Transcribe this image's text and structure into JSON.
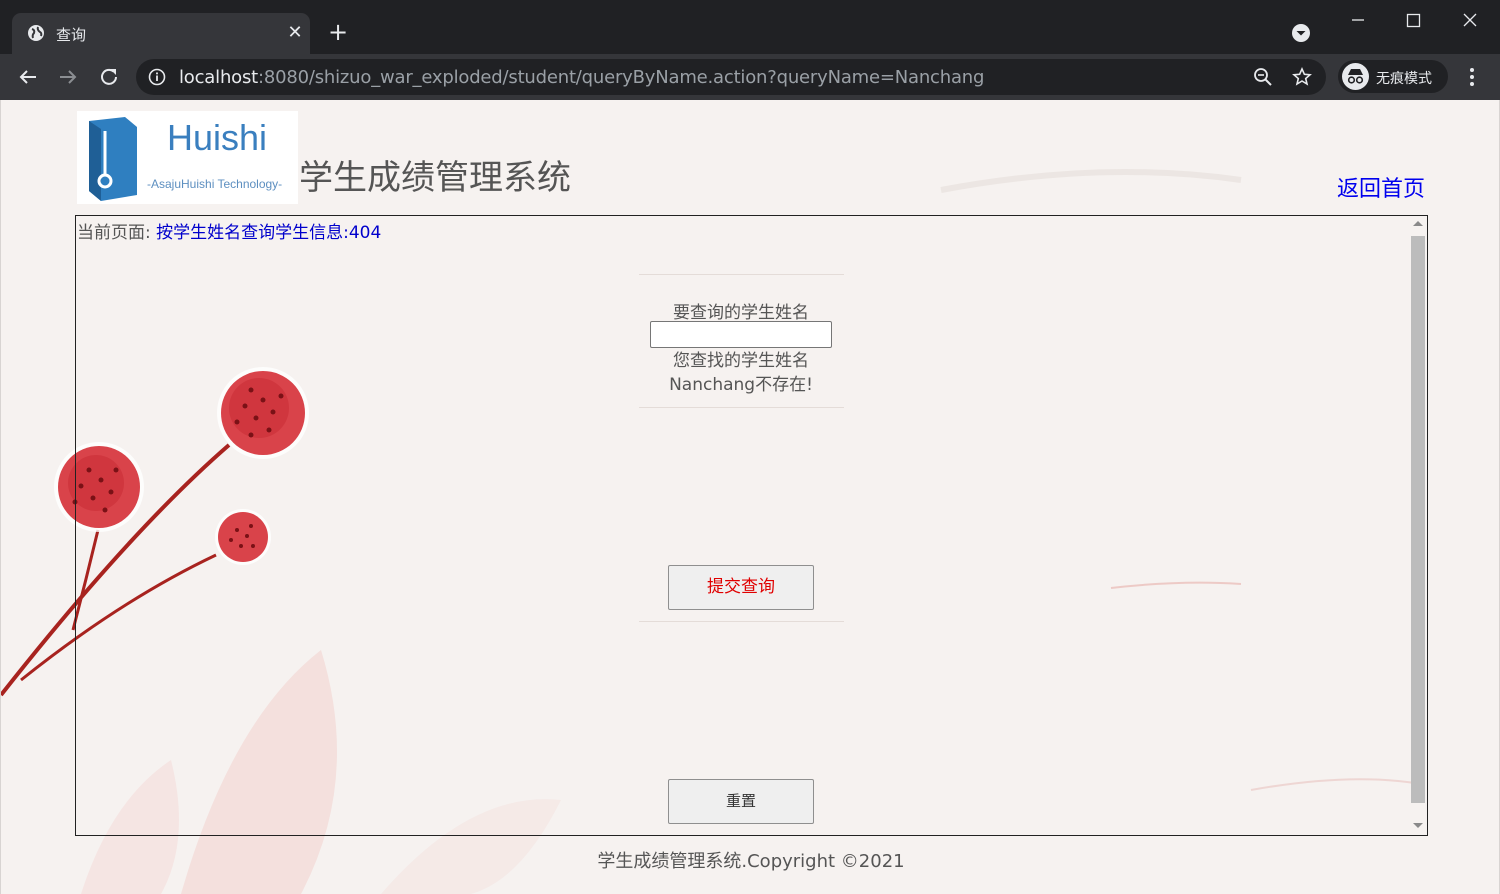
{
  "browser": {
    "tab_title": "查询",
    "url_host": "localhost",
    "url_rest": ":8080/shizuo_war_exploded/student/queryByName.action?queryName=Nanchang",
    "incognito_label": "无痕模式"
  },
  "header": {
    "logo_word": "Huishi",
    "logo_sub": "-AsajuHuishi Technology-",
    "site_title": "学生成绩管理系统",
    "home_link": "返回首页"
  },
  "breadcrumb": {
    "prefix": "当前页面:",
    "current": "按学生姓名查询学生信息:404"
  },
  "form": {
    "query_label": "要查询的学生姓名",
    "query_value": "",
    "message_line1": "您查找的学生姓名",
    "message_line2": "Nanchang不存在!",
    "submit_label": "提交查询",
    "reset_label": "重置"
  },
  "footer": {
    "copyright": "学生成绩管理系统.Copyright ©2021"
  },
  "colors": {
    "link": "#0000ee",
    "submit_text": "#e00000",
    "chrome_dark": "#202124",
    "chrome_toolbar": "#35363a"
  },
  "icons": [
    "globe-icon",
    "close-icon",
    "plus-icon",
    "tab-search-icon",
    "minimize-icon",
    "maximize-icon",
    "window-close-icon",
    "back-icon",
    "forward-icon",
    "reload-icon",
    "info-icon",
    "zoom-icon",
    "star-icon",
    "incognito-icon",
    "menu-icon"
  ]
}
